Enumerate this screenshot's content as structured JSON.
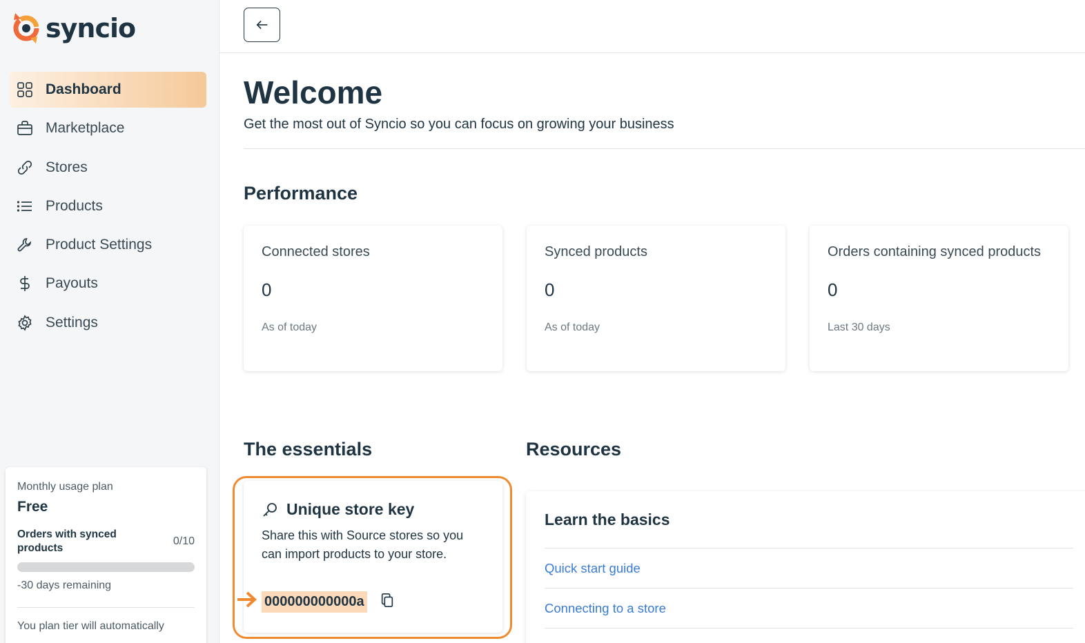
{
  "app": {
    "logo_text": "syncio"
  },
  "sidebar": {
    "items": [
      {
        "label": "Dashboard",
        "icon": "grid-icon",
        "active": true
      },
      {
        "label": "Marketplace",
        "icon": "shopping-bag-icon"
      },
      {
        "label": "Stores",
        "icon": "link-icon"
      },
      {
        "label": "Products",
        "icon": "list-icon"
      },
      {
        "label": "Product Settings",
        "icon": "wrench-icon"
      },
      {
        "label": "Payouts",
        "icon": "dollar-icon"
      },
      {
        "label": "Settings",
        "icon": "gear-icon"
      }
    ],
    "plan": {
      "label": "Monthly usage plan",
      "name": "Free",
      "orders_label": "Orders with synced products",
      "orders_count": "0/10",
      "usage_fraction": 0,
      "days_remaining": "-30 days remaining",
      "note": "You plan tier will automatically"
    }
  },
  "welcome": {
    "title": "Welcome",
    "subtitle": "Get the most out of Syncio so you can focus on growing your business"
  },
  "performance": {
    "title": "Performance",
    "cards": [
      {
        "label": "Connected stores",
        "value": "0",
        "foot": "As of today"
      },
      {
        "label": "Synced products",
        "value": "0",
        "foot": "As of today"
      },
      {
        "label": "Orders containing synced products",
        "value": "0",
        "foot": "Last 30 days"
      }
    ]
  },
  "essentials": {
    "title": "The essentials",
    "key_card": {
      "title": "Unique store key",
      "description": "Share this with Source stores so you can import products to your store.",
      "key_value": "000000000000a"
    }
  },
  "resources": {
    "title": "Resources",
    "card_title": "Learn the basics",
    "links": [
      "Quick start guide",
      "Connecting to a store"
    ]
  },
  "colors": {
    "accent": "#ef8a30",
    "link": "#3a7bd5",
    "text": "#1e3442"
  }
}
